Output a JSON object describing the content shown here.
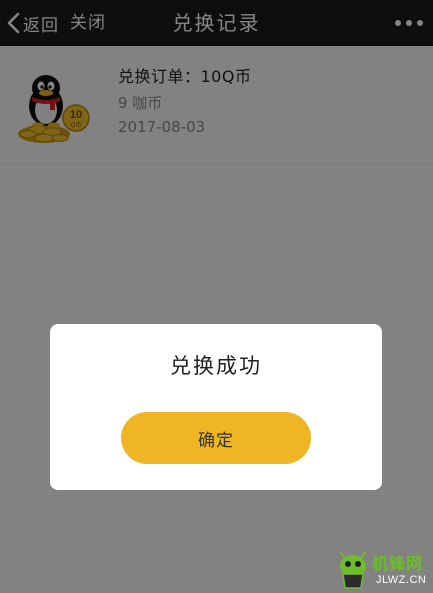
{
  "navbar": {
    "back_label": "返回",
    "close_label": "关闭",
    "title": "兑换记录",
    "more_icon": "more-dots-icon"
  },
  "record": {
    "title": "兑换订单：10Q币",
    "price": "9 咖币",
    "date": "2017-08-03",
    "thumb_badge": "10",
    "thumb_badge_unit": "Q币"
  },
  "dialog": {
    "title": "兑换成功",
    "confirm_label": "确定"
  },
  "watermark": {
    "brand": "机锋网",
    "domain": "JLWZ.CN"
  },
  "colors": {
    "navbar_bg": "#1b1b1b",
    "button_accent": "#efb524",
    "overlay": "rgba(0,0,0,0.48)"
  }
}
